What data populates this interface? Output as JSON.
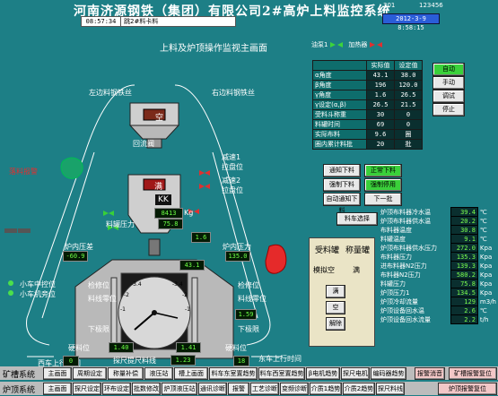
{
  "header": {
    "title": "河南济源钢铁（集团）有限公司2#高炉上料监控系统",
    "time": "08:57:34",
    "message": "跳2#料卡料",
    "label_301": "301",
    "label_123": "123456",
    "datetime": "2012-3-9 8:58:15"
  },
  "main_title": "上料及炉顶操作监视主画面",
  "legend": {
    "off": "油泵1",
    "on": "加热器",
    "off_color": "#3cd43c",
    "on_color": "#e03030"
  },
  "param_table": {
    "headers": [
      "实际值",
      "设定值"
    ],
    "rows": [
      {
        "label": "α角度",
        "actual": "43.1",
        "set": "38.0"
      },
      {
        "label": "β角度",
        "actual": "196",
        "set": "120.0"
      },
      {
        "label": "γ角度",
        "actual": "1.6",
        "set": "26.5"
      },
      {
        "label": "γ设定(α,β)",
        "actual": "26.5",
        "set": "21.5"
      },
      {
        "label": "受料斗称重",
        "actual": "30",
        "set": "0"
      },
      {
        "label": "料罐时间",
        "actual": "69",
        "set": "0"
      },
      {
        "label": "实际布料",
        "actual": "9.6",
        "set": "圈"
      },
      {
        "label": "圈内累计料批",
        "actual": "20",
        "set": "批"
      }
    ]
  },
  "mode_buttons": [
    "自动",
    "手动",
    "调试",
    "停止"
  ],
  "ctrl_buttons": {
    "notify_lower": "通知下料",
    "normal_lower": "正常下料",
    "force_lower": "强制下料",
    "force_shutdown": "强制停用",
    "auto_notify": "自动通知下料",
    "next_batch": "下一批",
    "cart_select": "料车选择"
  },
  "right_values": [
    {
      "label": "炉顶布料器冷水温",
      "value": "39.4",
      "unit": "℃"
    },
    {
      "label": "炉顶布料器供水温",
      "value": "20.2",
      "unit": "℃"
    },
    {
      "label": "布料器温度",
      "value": "30.8",
      "unit": "℃"
    },
    {
      "label": "料罐温度",
      "value": "9.1",
      "unit": "℃"
    },
    {
      "label": "炉顶布料器供水压力",
      "value": "272.0",
      "unit": "Kpa"
    },
    {
      "label": "布料器压力",
      "value": "135.3",
      "unit": "Kpa"
    },
    {
      "label": "进布料器N2压力",
      "value": "139.3",
      "unit": "Kpa"
    },
    {
      "label": "布料器N2压力",
      "value": "580.2",
      "unit": "Kpa"
    },
    {
      "label": "料罐压力",
      "value": "75.8",
      "unit": "Kpa"
    },
    {
      "label": "炉顶压力1",
      "value": "134.5",
      "unit": "Kpa"
    },
    {
      "label": "炉顶冷却流量",
      "value": "129",
      "unit": "m3/h"
    },
    {
      "label": "炉顶设备回水温",
      "value": "2.6",
      "unit": "℃"
    },
    {
      "label": "炉顶设备回水流量",
      "value": "2.2",
      "unit": "t/h"
    }
  ],
  "valve_panel": {
    "col1": "受料罐",
    "col2": "称量罐",
    "col1_status": "模拟空",
    "col2_status": "满",
    "btn_full": "满",
    "btn_empty": "空",
    "btn_release": "解除"
  },
  "furnace": {
    "top_hopper": "空",
    "mid_hopper": "满",
    "kk_label": "KK",
    "kk_value": "8413",
    "kk_unit": "Kg",
    "hopper_temp": "75.8",
    "hopper_temp_label": "料罐压力",
    "pressure_left": "-60.9",
    "pressure_right": "135.0",
    "pressure_label_left": "炉内压差",
    "pressure_label_right": "炉内压力",
    "value_43": "43.1",
    "value_1_6": "1.6",
    "value_1_59": "1.59",
    "value_1_40": "1.40",
    "value_1_41": "1.41",
    "value_1_23": "1.23",
    "gauge_alpha": "43.1",
    "gauge_label_l": "检修位",
    "gauge_label_l2": "料线零位",
    "gauge_label_r": "检修位",
    "gauge_label_r2": "料线零位",
    "lbl_lower_limit": "下极限",
    "lbl_lower_limit2": "下极限",
    "lbl_probe_l": "探尺提尺到位",
    "lbl_probe_r": "探尺提尺到位",
    "lbl_sensor_l": "硬料位",
    "lbl_sensor_r": "硬料位",
    "lbl_level_l": "料线",
    "lbl_level_r": "料线",
    "lbl_car_up": "小车中控位",
    "lbl_car_down": "小车机旁位",
    "lbl_left_top": "左边料钢铁丝",
    "lbl_right_top": "右边料钢铁丝",
    "lbl_cooling": "减速1",
    "lbl_cooling2": "减速2",
    "lbl_pos": "拉盘位",
    "lbl_pos2": "拉盘位",
    "lbl_drop": "落料报警",
    "lbl_level_row": "回流阀",
    "lbl_red_text": "布料溜槽",
    "lbl_sp": "西车上行时间",
    "lbl_sp2": "东车上行时间",
    "cnt_left": "0",
    "cnt_right": "18",
    "probe_btn": "探尺提尺料线",
    "probe_val1": "1.40",
    "probe_val2": "1.41"
  },
  "bar1": {
    "label": "矿槽系统",
    "buttons": [
      "主画面",
      "周期设定",
      "称量补偿",
      "液压站",
      "槽上画面",
      "料车东室置趋势",
      "料车西室置趋势",
      "β电机趋势",
      "探尺电机",
      "编码器趋势",
      "报警消音",
      "矿槽报警复位"
    ]
  },
  "bar2": {
    "label": "炉顶系统",
    "buttons": [
      "主画面",
      "探尺设定",
      "环布设定",
      "批数修改",
      "炉顶液压站",
      "通讯诊断",
      "报警",
      "工艺诊断",
      "变频诊断",
      "介质1趋势",
      "介质2趋势",
      "探尺料线",
      "炉顶报警复位"
    ]
  }
}
